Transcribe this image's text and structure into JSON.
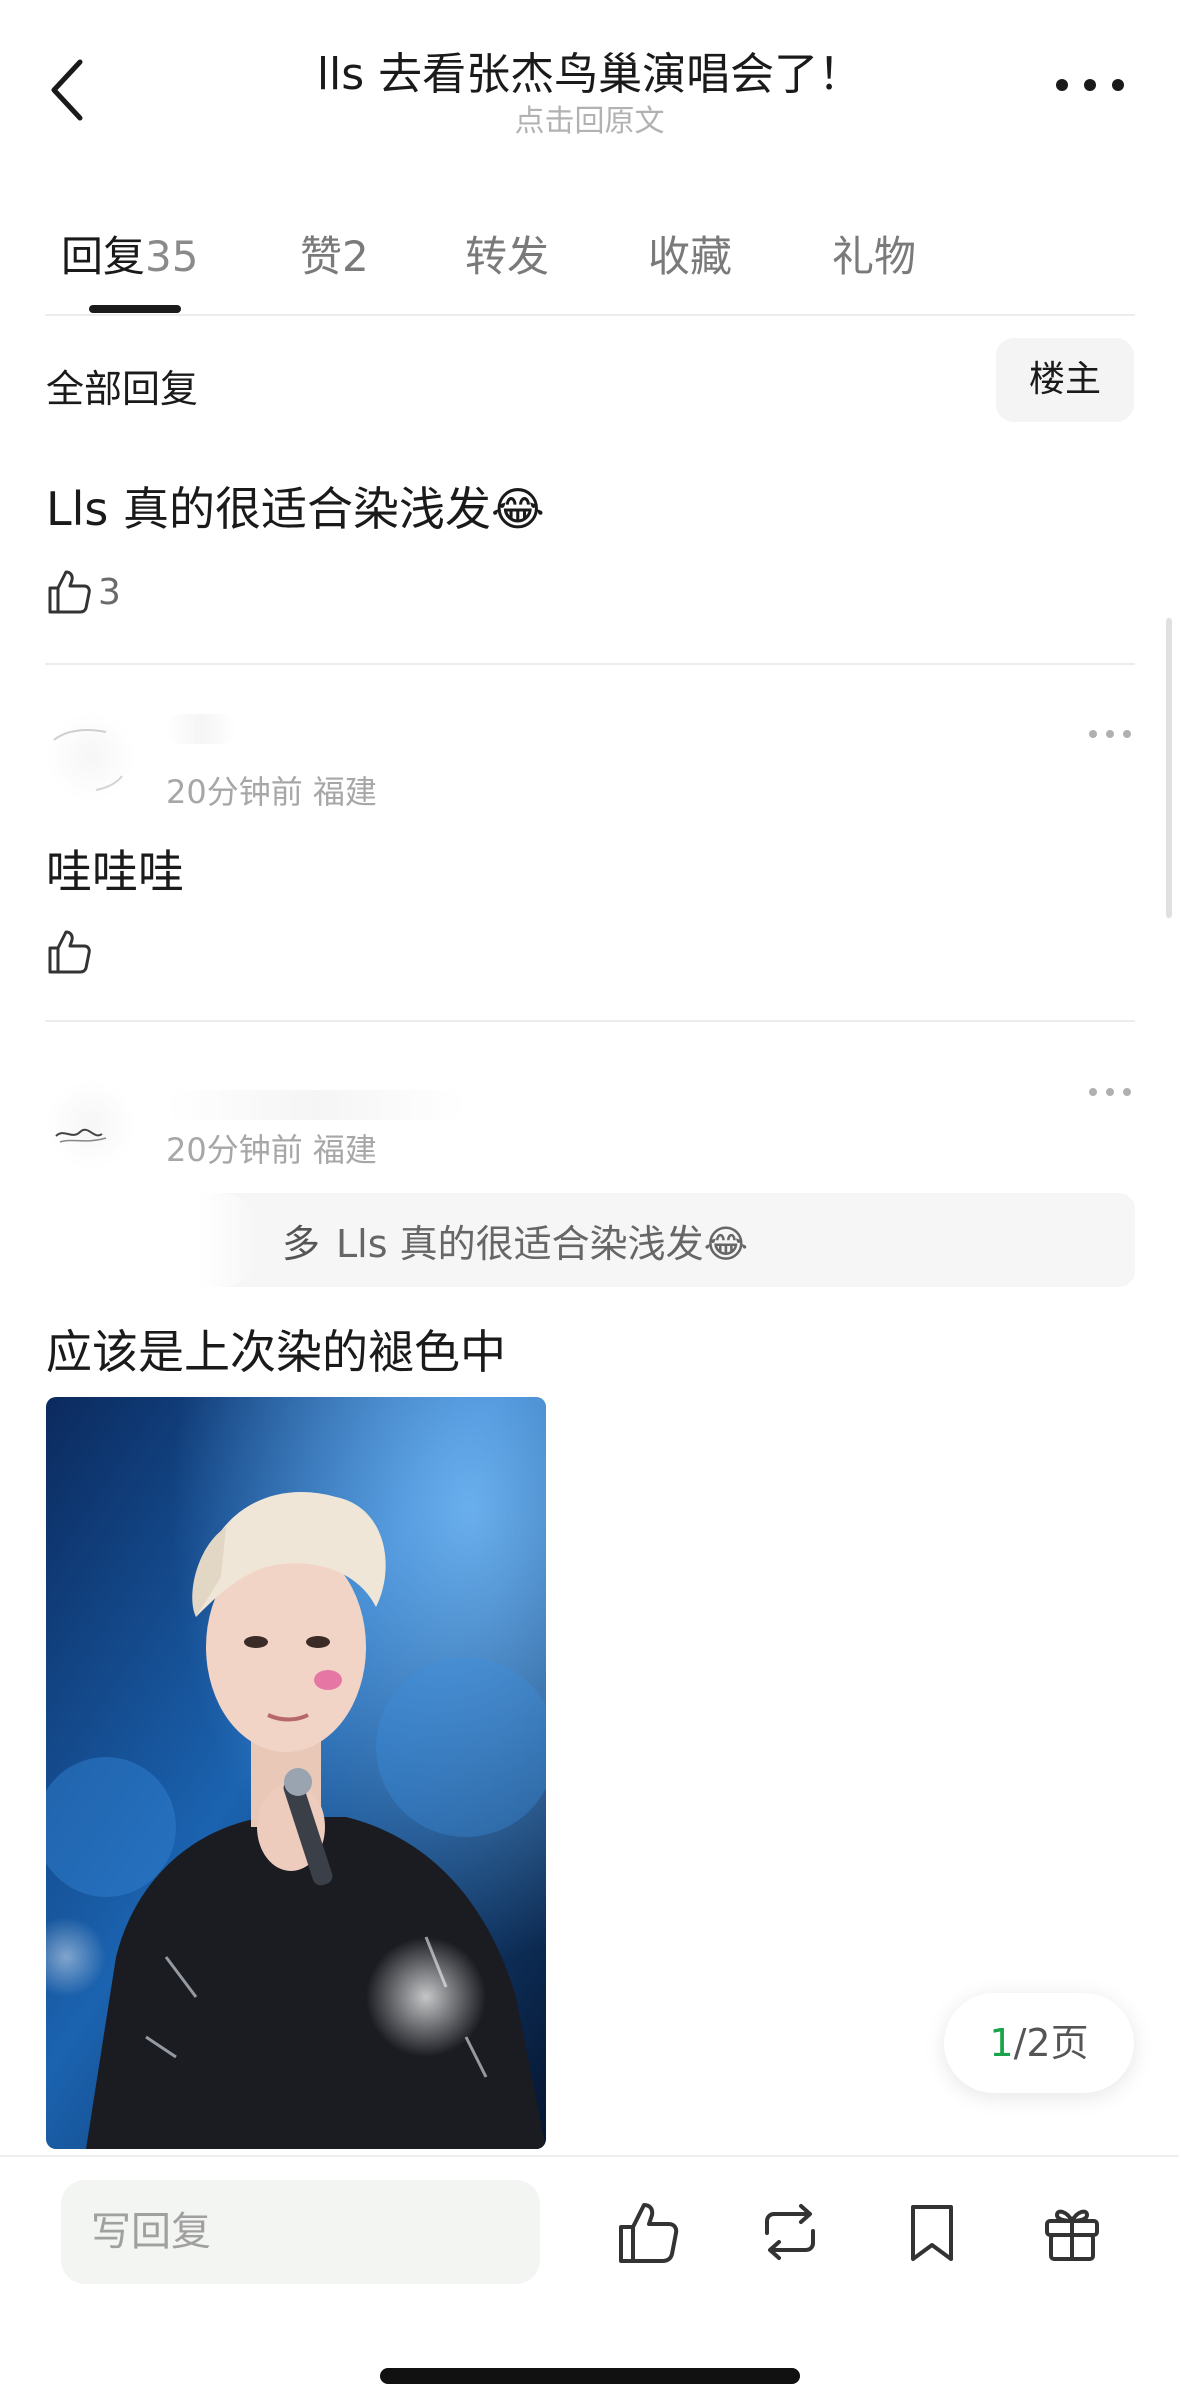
{
  "header": {
    "title": "lls 去看张杰鸟巢演唱会了！",
    "subtitle": "点击回原文"
  },
  "tabs": [
    {
      "label": "回复",
      "count": "35",
      "active": true
    },
    {
      "label": "赞",
      "count": "2",
      "active": false
    },
    {
      "label": "转发",
      "count": "",
      "active": false
    },
    {
      "label": "收藏",
      "count": "",
      "active": false
    },
    {
      "label": "礼物",
      "count": "",
      "active": false
    }
  ],
  "section": {
    "title": "全部回复",
    "op_button": "楼主"
  },
  "post": {
    "text": "Lls 真的很适合染浅发😂",
    "likes": "3"
  },
  "comments": [
    {
      "time": "20分钟前",
      "location": "福建",
      "text": "哇哇哇",
      "likes": ""
    },
    {
      "time": "20分钟前",
      "location": "福建",
      "quote_partial": "多",
      "quote": "Lls 真的很适合染浅发😂",
      "text": "应该是上次染的褪色中",
      "has_image": true
    }
  ],
  "pagination": {
    "current": "1",
    "rest": "/2页"
  },
  "bottom_bar": {
    "reply_placeholder": "写回复"
  },
  "icons": {
    "back": "chevron-left-icon",
    "more": "more-dots-icon",
    "like": "thumbs-up-icon",
    "repost": "repost-icon",
    "bookmark": "bookmark-icon",
    "gift": "gift-icon"
  },
  "colors": {
    "accent_green": "#1aa34a",
    "text_primary": "#1a1a1a",
    "text_secondary": "#a7a7a7",
    "input_bg": "#f3f5f2"
  }
}
